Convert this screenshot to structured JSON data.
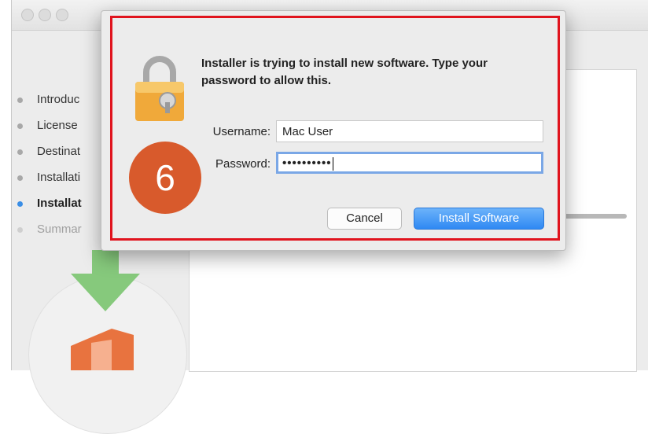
{
  "installer": {
    "steps": [
      {
        "label": "Introduc",
        "state": "done"
      },
      {
        "label": "License",
        "state": "done"
      },
      {
        "label": "Destinat",
        "state": "done"
      },
      {
        "label": "Installati",
        "state": "done"
      },
      {
        "label": "Installat",
        "state": "active"
      },
      {
        "label": "Summar",
        "state": "pending"
      }
    ]
  },
  "dialog": {
    "message": "Installer is trying to install new software. Type your password to allow this.",
    "username_label": "Username:",
    "username_value": "Mac User",
    "password_label": "Password:",
    "password_value": "••••••••••",
    "cancel_label": "Cancel",
    "install_label": "Install Software"
  },
  "annotation": {
    "step_number": "6",
    "highlight_color": "#e0141e",
    "badge_color": "#d85a2c"
  },
  "icons": [
    "lock-icon",
    "download-arrow-icon",
    "office-icon"
  ]
}
